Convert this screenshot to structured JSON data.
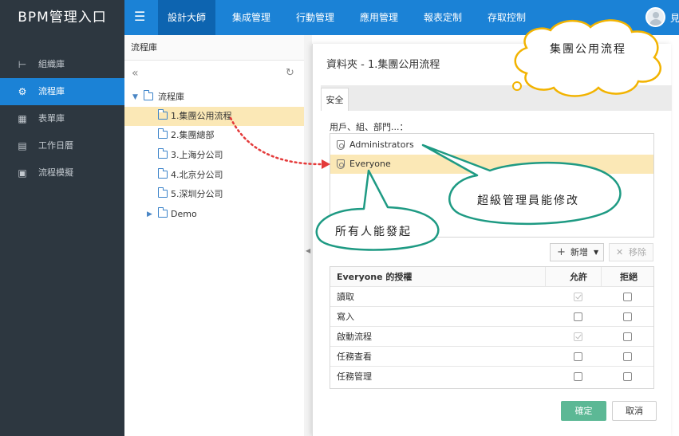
{
  "brand": "BPM管理入口",
  "topnav": {
    "menu_icon": "menu-icon",
    "items": [
      "設計大師",
      "集成管理",
      "行動管理",
      "應用管理",
      "報表定制",
      "存取控制"
    ],
    "avatar_tail": "見"
  },
  "sidebar": {
    "items": [
      {
        "label": "組織庫",
        "icon": "org-icon"
      },
      {
        "label": "流程庫",
        "icon": "process-icon"
      },
      {
        "label": "表單庫",
        "icon": "form-icon"
      },
      {
        "label": "工作日曆",
        "icon": "calendar-icon"
      },
      {
        "label": "流程模擬",
        "icon": "simulation-icon"
      }
    ]
  },
  "tree": {
    "header": "流程庫",
    "root": "流程庫",
    "nodes": [
      "1.集團公用流程",
      "2.集團總部",
      "3.上海分公司",
      "4.北京分公司",
      "5.深圳分公司",
      "Demo"
    ]
  },
  "dialog": {
    "title": "資料夾 - 1.集團公用流程",
    "tab": "安全",
    "users_title": "用戶、組、部門...：",
    "users": [
      "Administrators",
      "Everyone"
    ],
    "add_label": "新增",
    "remove_label": "移除",
    "table_head": {
      "name": "Everyone 的授權",
      "allow": "允許",
      "deny": "拒絕"
    },
    "rows": [
      {
        "name": "讀取",
        "allow": true,
        "deny": false
      },
      {
        "name": "寫入",
        "allow": false,
        "deny": false
      },
      {
        "name": "啟動流程",
        "allow": true,
        "deny": false
      },
      {
        "name": "任務查看",
        "allow": false,
        "deny": false
      },
      {
        "name": "任務管理",
        "allow": false,
        "deny": false
      }
    ],
    "ok_label": "確定",
    "cancel_label": "取消"
  },
  "callouts": {
    "top": "集團公用流程",
    "admin": "超級管理員能修改",
    "everyone": "所有人能發起"
  },
  "colors": {
    "topbar": "#1b82d6",
    "sidebar": "#2d3740",
    "selected_row": "#fbe8b6",
    "callout_stroke": "#1e9a83",
    "cloud_stroke": "#f2b300",
    "arrow": "#e43a3a",
    "ok_button": "#5cb895"
  }
}
